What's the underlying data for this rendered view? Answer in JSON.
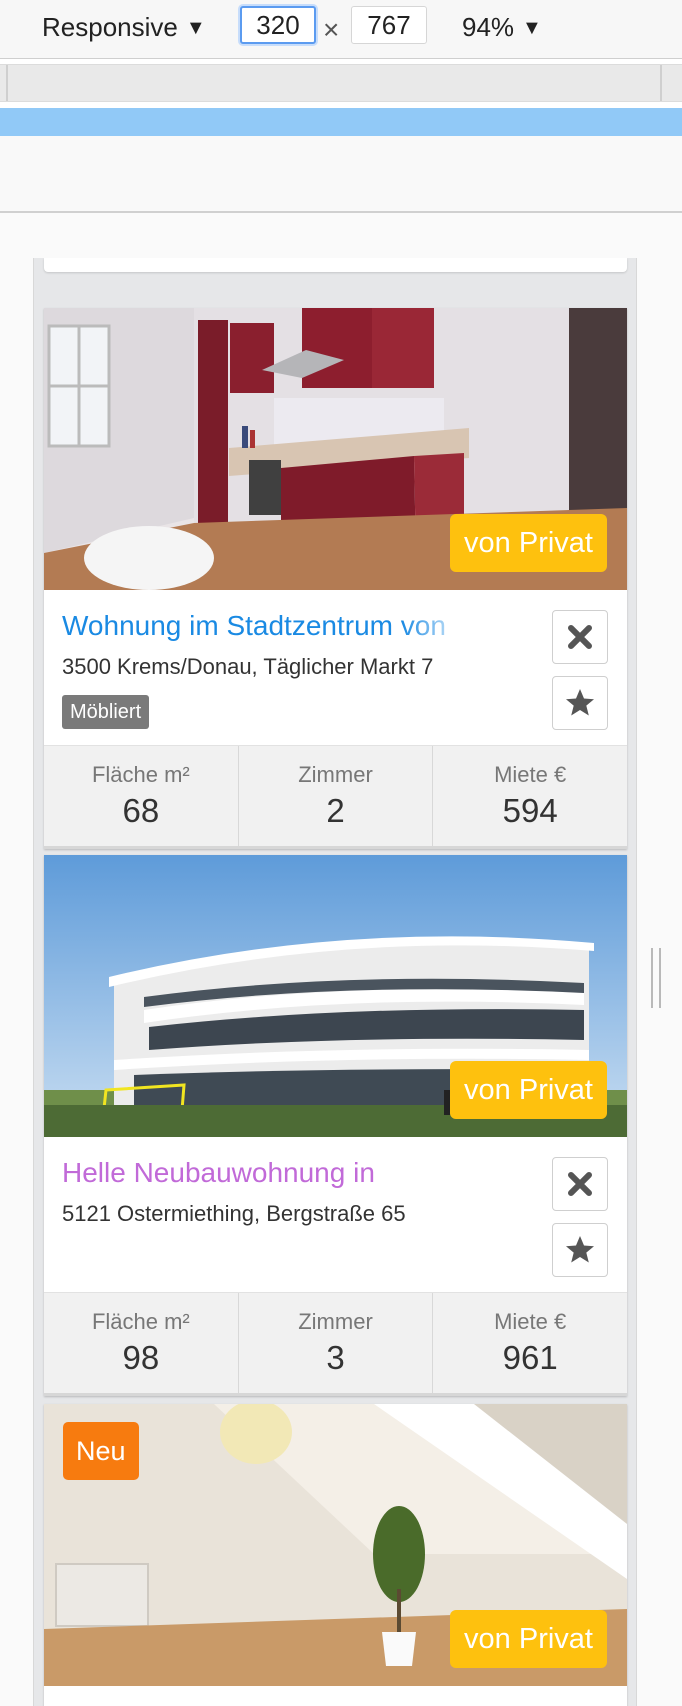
{
  "toolbar": {
    "mode_label": "Responsive",
    "mode_caret": "▼",
    "width_value": "320",
    "times_sign": "×",
    "height_value": "767",
    "zoom_label": "94%",
    "zoom_caret": "▼"
  },
  "colors": {
    "link_blue": "#1a8ae3",
    "visited_violet": "#c16ad8",
    "badge_privat": "#fec10e",
    "badge_neu": "#f77b0f",
    "media_bar": "#91c9f7"
  },
  "stat_labels": {
    "area": "Fläche m²",
    "rooms": "Zimmer",
    "rent": "Miete €"
  },
  "listings": [
    {
      "title": "Wohnung im Stadtzentrum von",
      "address": "3500 Krems/Donau, Täglicher Markt 7",
      "tag": "Möbliert",
      "badge": "von Privat",
      "area": "68",
      "rooms": "2",
      "rent": "594",
      "photo": "kitchen-photo"
    },
    {
      "title": "Helle Neubauwohnung in",
      "address": "5121 Ostermiething, Bergstraße 65",
      "badge": "von Privat",
      "area": "98",
      "rooms": "3",
      "rent": "961",
      "photo": "building-photo"
    },
    {
      "badge_new": "Neu",
      "badge": "von Privat",
      "photo": "attic-room-photo"
    }
  ]
}
